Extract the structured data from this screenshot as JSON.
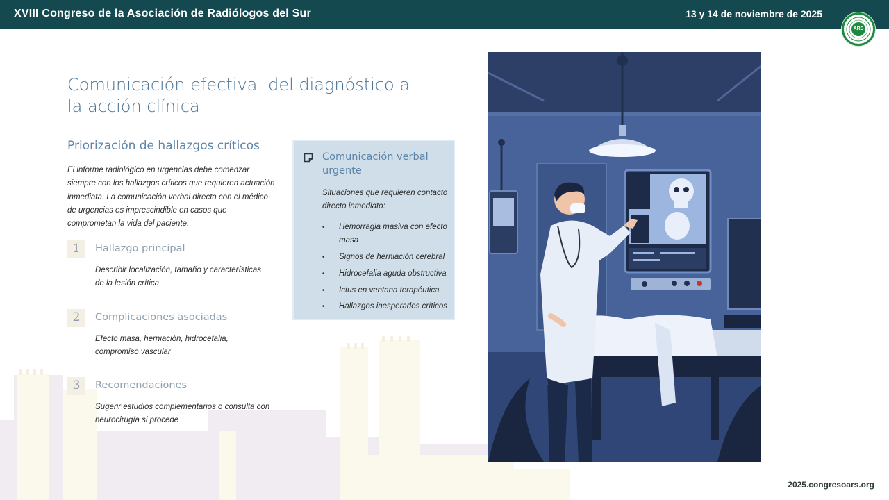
{
  "header": {
    "conference_title": "XVIII Congreso de la Asociación de Radiólogos del Sur",
    "date": "13 y 14 de noviembre de 2025",
    "logo_text": "ARS",
    "logo_ring_text": "ASOCIACIÓN RADIÓLOGOS SUR",
    "brand_color": "#14494f"
  },
  "main": {
    "title": "Comunicación efectiva: del diagnóstico a la acción clínica",
    "section_title": "Priorización de hallazgos críticos",
    "intro": "El informe radiológico en urgencias debe comenzar siempre con los hallazgos críticos que requieren actuación inmediata. La comunicación verbal directa con el médico de urgencias es imprescindible en casos que comprometan la vida del paciente.",
    "steps": [
      {
        "number": "1",
        "title": "Hallazgo principal",
        "description": "Describir localización, tamaño y características de la lesión crítica"
      },
      {
        "number": "2",
        "title": "Complicaciones asociadas",
        "description": "Efecto masa, herniación, hidrocefalia, compromiso vascular"
      },
      {
        "number": "3",
        "title": "Recomendaciones",
        "description": "Sugerir estudios complementarios o consulta con neurocirugía si procede"
      }
    ]
  },
  "callout": {
    "icon": "note-icon",
    "title": "Comunicación verbal urgente",
    "subtitle": "Situaciones que requieren contacto directo inmediato:",
    "items": [
      "Hemorragia masiva con efecto masa",
      "Signos de herniación cerebral",
      "Hidrocefalia aguda obstructiva",
      "Ictus en ventana terapéutica",
      "Hallazgos inesperados críticos"
    ]
  },
  "footer": {
    "url": "2025.congresoars.org"
  }
}
